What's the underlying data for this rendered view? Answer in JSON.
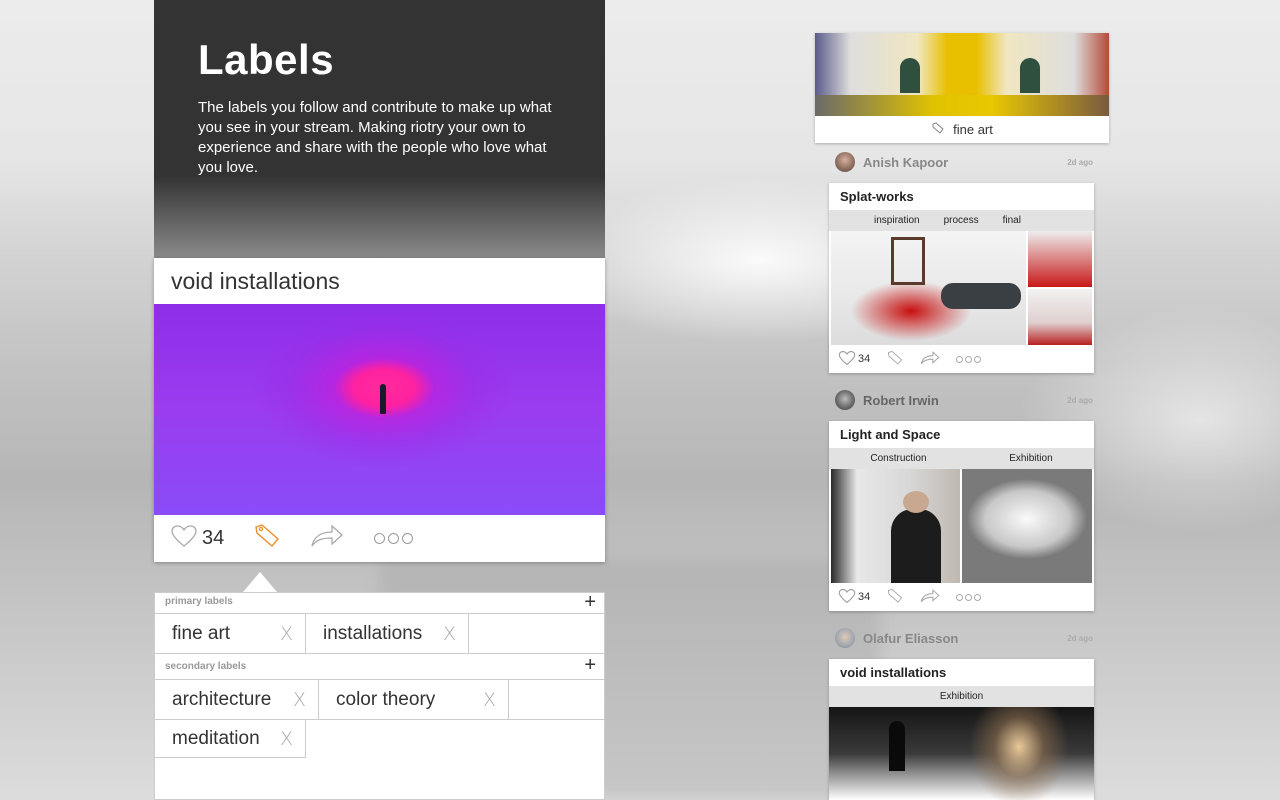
{
  "header": {
    "title": "Labels",
    "description": "The labels you follow and contribute to make up what you see in your stream. Making riotry your own to experience and share with the people who love what you love."
  },
  "main_card": {
    "title": "void installations",
    "like_count": "34"
  },
  "primary_labels": {
    "heading": "primary labels",
    "add": "+",
    "tags": [
      "fine art",
      "installations"
    ],
    "remove": "X"
  },
  "secondary_labels": {
    "heading": "secondary labels",
    "add": "+",
    "tags": [
      "architecture",
      "color theory",
      "meditation"
    ],
    "remove": "X"
  },
  "right": {
    "fineart_label": "fine art",
    "posts": [
      {
        "author": "Anish Kapoor",
        "time": "2d ago",
        "title": "Splat-works",
        "tabs": [
          "inspiration",
          "process",
          "final"
        ],
        "likes": "34"
      },
      {
        "author": "Robert Irwin",
        "time": "2d ago",
        "title": "Light and Space",
        "tabs": [
          "Construction",
          "Exhibition"
        ],
        "likes": "34"
      },
      {
        "author": "Olafur Eliasson",
        "time": "2d ago",
        "title": "void installations",
        "tabs": [
          "Exhibition"
        ]
      }
    ]
  },
  "colors": {
    "header_bg": "#333333",
    "accent_orange": "#e8902a",
    "void_purple": "#8e2ee8",
    "void_pink": "#ff22a0"
  }
}
